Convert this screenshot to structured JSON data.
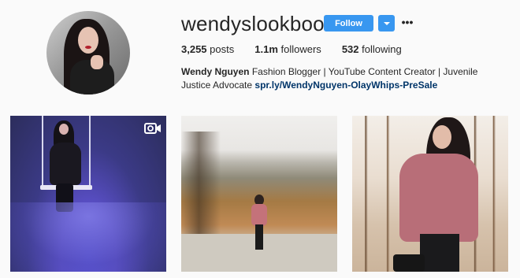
{
  "profile": {
    "username": "wendyslookbook",
    "verified_icon": "verified-badge-icon",
    "follow_label": "Follow",
    "more_label": "•••",
    "stats": {
      "posts_count": "3,255",
      "posts_label": "posts",
      "followers_count": "1.1m",
      "followers_label": "followers",
      "following_count": "532",
      "following_label": "following"
    },
    "bio": {
      "name": "Wendy Nguyen",
      "text": "Fashion Blogger | YouTube Content Creator | Juvenile Justice Advocate",
      "link": "spr.ly/WendyNguyen-OlayWhips-PreSale"
    }
  },
  "posts": [
    {
      "type": "video",
      "icon": "video-camera-icon"
    },
    {
      "type": "photo"
    },
    {
      "type": "photo"
    }
  ],
  "colors": {
    "accent": "#3897f0",
    "text": "#262626",
    "link": "#003569",
    "background": "#fafafa"
  }
}
